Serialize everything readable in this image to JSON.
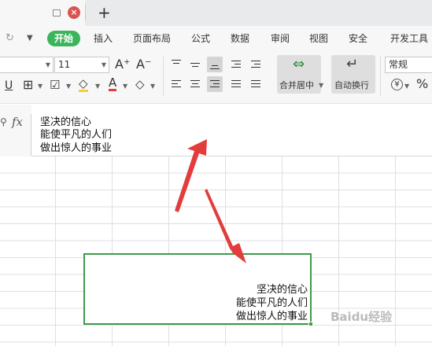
{
  "titlebar": {
    "new_tab_glyph": "+",
    "close_glyph": "×"
  },
  "menu": {
    "items": [
      "开始",
      "插入",
      "页面布局",
      "公式",
      "数据",
      "审阅",
      "视图",
      "安全",
      "开发工具"
    ]
  },
  "toolbar": {
    "font_size": "11",
    "number_format": "常规",
    "merge_center_label": "合并居中",
    "wrap_text_label": "自动换行",
    "increase_font_glyph": "A⁺",
    "decrease_font_glyph": "A⁻",
    "percent_glyph": "%",
    "currency_glyph": "¥"
  },
  "formula_bar": {
    "fx_label": "fx",
    "lines": [
      "坚决的信心",
      "能使平凡的人们",
      "做出惊人的事业"
    ]
  },
  "selected_cell": {
    "lines": [
      "坚决的信心",
      "能使平凡的人们",
      "做出惊人的事业"
    ]
  },
  "watermark": {
    "text": "Baidu经验"
  },
  "colors": {
    "accent_green": "#3bb45a",
    "selection_border": "#3f9b4b",
    "arrow_red": "#e23c3c",
    "close_red": "#d9534f"
  },
  "icons": [
    "restore-icon",
    "close-tab-icon",
    "new-tab-icon",
    "redo-icon",
    "dropdown-icon",
    "underline-icon",
    "border-icon",
    "fill-color-icon",
    "font-color-icon",
    "clear-format-icon",
    "merge-center-icon",
    "wrap-text-icon",
    "currency-icon",
    "percent-icon"
  ]
}
